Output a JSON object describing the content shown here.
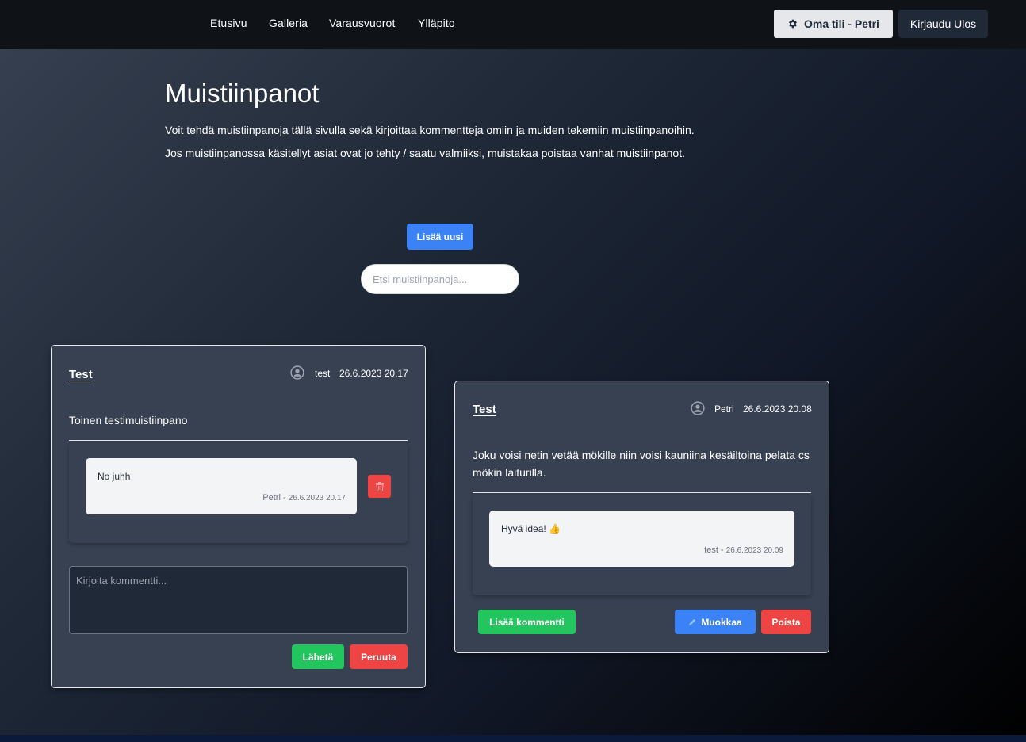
{
  "nav": {
    "links": [
      "Etusivu",
      "Galleria",
      "Varausvuorot",
      "Ylläpito"
    ],
    "account_label": "Oma tili - Petri",
    "logout_label": "Kirjaudu Ulos"
  },
  "header": {
    "title": "Muistiinpanot",
    "intro_1": "Voit tehdä muistiinpanoja tällä sivulla sekä kirjoittaa kommentteja omiin ja muiden tekemiin muistiinpanoihin.",
    "intro_2": "Jos muistiinpanossa käsitellyt asiat ovat jo tehty / saatu valmiiksi, muistakaa poistaa vanhat muistiinpanot."
  },
  "toolbar": {
    "add_label": "Lisää uusi",
    "search_placeholder": "Etsi muistiinpanoja..."
  },
  "notes": [
    {
      "title": "Test",
      "author": "test",
      "date": "26.6.2023 20.17",
      "body": "Toinen testimuistiinpano",
      "comment": {
        "text": "No juhh",
        "author": "Petri -",
        "date": "26.6.2023 20.17"
      },
      "comment_placeholder": "Kirjoita kommentti...",
      "send_label": "Lähetä",
      "cancel_label": "Peruuta"
    },
    {
      "title": "Test",
      "author": "Petri",
      "date": "26.6.2023 20.08",
      "body": "Joku voisi netin vetää mökille niin voisi kauniina kesäiltoina pelata cs mökin laiturilla.",
      "comment": {
        "text": "Hyvä idea! 👍",
        "author": "test -",
        "date": "26.6.2023 20.09"
      },
      "add_comment_label": "Lisää kommentti",
      "edit_label": "Muokkaa",
      "delete_label": "Poista"
    }
  ],
  "colors": {
    "primary": "#3b82f6",
    "success": "#22c55e",
    "danger": "#ef4444",
    "card_bg": "#374151",
    "nav_bg": "#0f1318"
  },
  "icons": {
    "account": "gear-icon",
    "user": "user-circle-icon",
    "delete_comment": "trash-icon",
    "edit": "pencil-icon"
  }
}
